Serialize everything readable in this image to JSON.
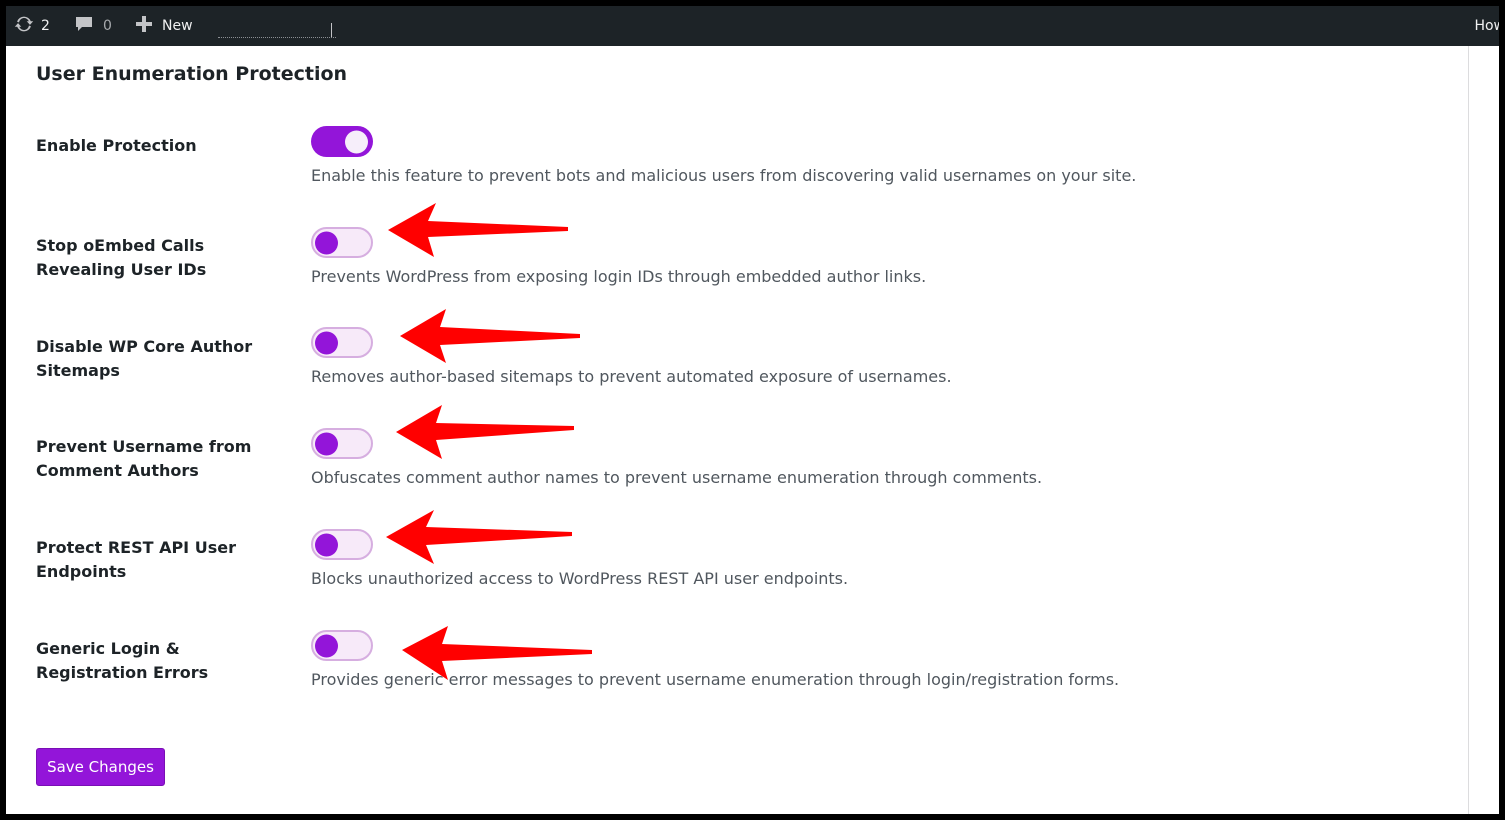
{
  "admin_bar": {
    "updates_icon": "refresh-icon",
    "updates_count": "2",
    "comments_icon": "comment-bubble-icon",
    "comments_count": "0",
    "new_icon": "plus-icon",
    "new_label": "New",
    "howdy_label": "How"
  },
  "section": {
    "title": "User Enumeration Protection"
  },
  "settings": [
    {
      "label": "Enable Protection",
      "enabled": true,
      "description": "Enable this feature to prevent bots and malicious users from discovering valid usernames on your site."
    },
    {
      "label": "Stop oEmbed Calls Revealing User IDs",
      "enabled": false,
      "description": "Prevents WordPress from exposing login IDs through embedded author links."
    },
    {
      "label": "Disable WP Core Author Sitemaps",
      "enabled": false,
      "description": "Removes author-based sitemaps to prevent automated exposure of usernames."
    },
    {
      "label": "Prevent Username from Comment Authors",
      "enabled": false,
      "description": "Obfuscates comment author names to prevent username enumeration through comments."
    },
    {
      "label": "Protect REST API User Endpoints",
      "enabled": false,
      "description": "Blocks unauthorized access to WordPress REST API user endpoints."
    },
    {
      "label": "Generic Login & Registration Errors",
      "enabled": false,
      "description": "Provides generic error messages to prevent username enumeration through login/registration forms."
    }
  ],
  "save_button": {
    "label": "Save Changes"
  },
  "colors": {
    "accent": "#9315d9",
    "toggle_off_bg": "#f7eaf9",
    "annotation_arrow": "#ff0000",
    "admin_bar_bg": "#1d2327"
  }
}
